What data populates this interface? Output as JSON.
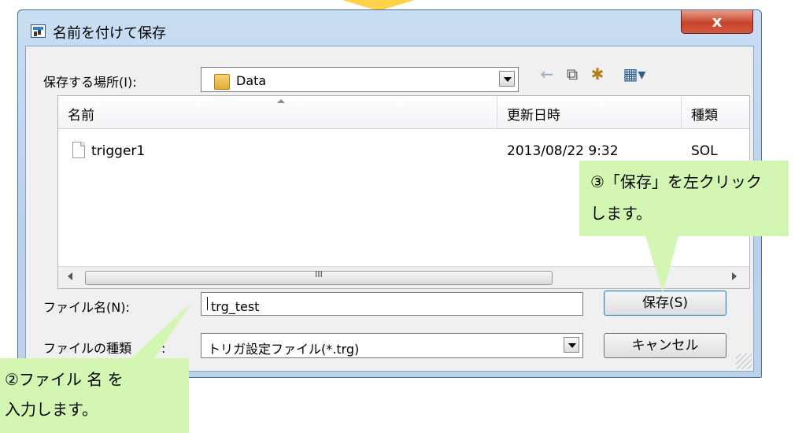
{
  "window": {
    "title": "名前を付けて保存",
    "close_label": "x"
  },
  "location": {
    "label": "保存する場所(I):",
    "value": "Data"
  },
  "toolbar": {
    "back_icon": "←",
    "up_icon": "⧉",
    "new_folder_icon": "✱",
    "view_icon": "▦▾"
  },
  "list": {
    "columns": [
      "名前",
      "更新日時",
      "種類"
    ],
    "rows": [
      {
        "name": "trigger1",
        "modified": "2013/08/22 9:32",
        "type": "SOL"
      }
    ],
    "scroll_thumb_text": "III"
  },
  "filename": {
    "label": "ファイル名(N):",
    "value": "trg_test"
  },
  "filetype": {
    "label": "ファイルの種類",
    "label_tail": ":",
    "value": "トリガ設定ファイル(*.trg)"
  },
  "buttons": {
    "save": "保存(S)",
    "cancel": "キャンセル"
  },
  "callouts": {
    "save_hint": {
      "line1": "③「保存」を左クリック",
      "line2": "します。"
    },
    "name_hint": {
      "line1": "②ファイル 名 を",
      "line2": "入力します。"
    }
  },
  "colors": {
    "callout_bg": "#d3f7b3",
    "arrow": "#ffd24a",
    "window_frame": "#b8d1ec",
    "close_red": "#c8432b"
  }
}
